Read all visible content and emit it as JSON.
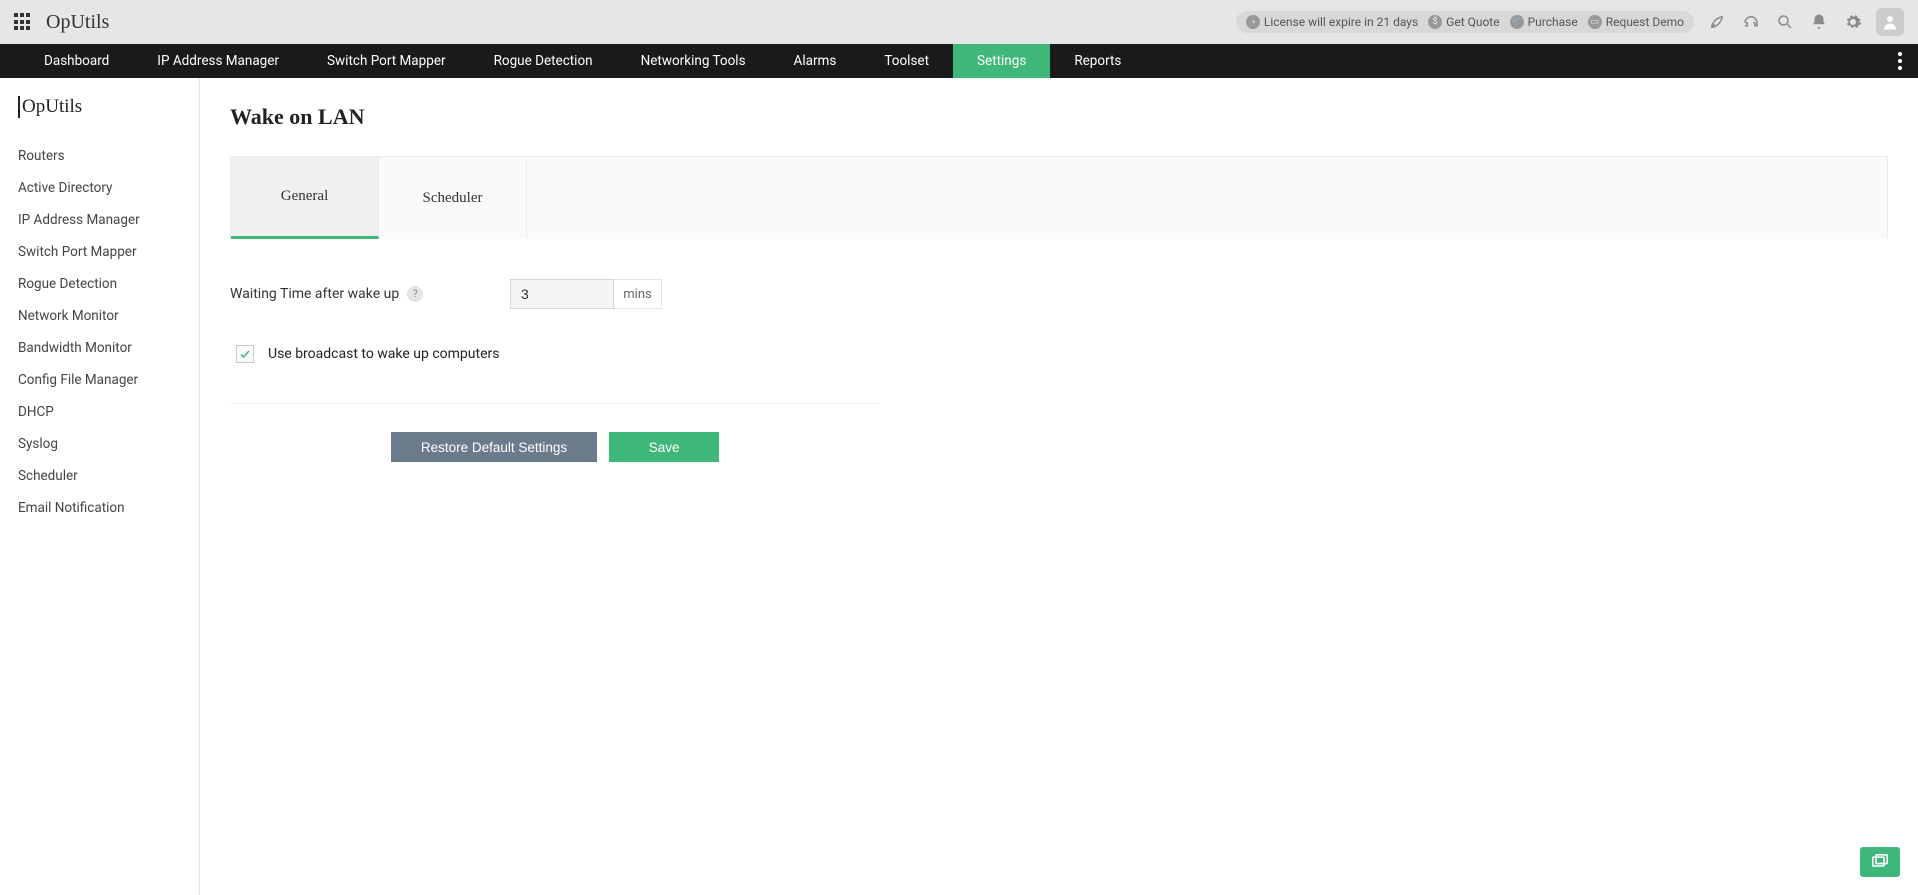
{
  "header": {
    "product": "OpUtils",
    "license_notice": "License will expire in 21 days",
    "links": {
      "quote": "Get Quote",
      "purchase": "Purchase",
      "demo": "Request Demo"
    }
  },
  "topnav": {
    "items": [
      {
        "label": "Dashboard"
      },
      {
        "label": "IP Address Manager"
      },
      {
        "label": "Switch Port Mapper"
      },
      {
        "label": "Rogue Detection"
      },
      {
        "label": "Networking Tools"
      },
      {
        "label": "Alarms"
      },
      {
        "label": "Toolset"
      },
      {
        "label": "Settings",
        "active": true
      },
      {
        "label": "Reports"
      }
    ]
  },
  "sidebar": {
    "title": "OpUtils",
    "items": [
      {
        "label": "Routers"
      },
      {
        "label": "Active Directory"
      },
      {
        "label": "IP Address Manager"
      },
      {
        "label": "Switch Port Mapper"
      },
      {
        "label": "Rogue Detection"
      },
      {
        "label": "Network Monitor"
      },
      {
        "label": "Bandwidth Monitor"
      },
      {
        "label": "Config File Manager"
      },
      {
        "label": "DHCP"
      },
      {
        "label": "Syslog"
      },
      {
        "label": "Scheduler"
      },
      {
        "label": "Email Notification"
      }
    ]
  },
  "page": {
    "title": "Wake on LAN",
    "tabs": {
      "general": "General",
      "scheduler": "Scheduler"
    },
    "form": {
      "wait_label": "Waiting Time after wake up",
      "wait_value": "3",
      "wait_unit": "mins",
      "broadcast_label": "Use broadcast to wake up computers",
      "broadcast_checked": true
    },
    "buttons": {
      "restore": "Restore Default Settings",
      "save": "Save"
    }
  }
}
